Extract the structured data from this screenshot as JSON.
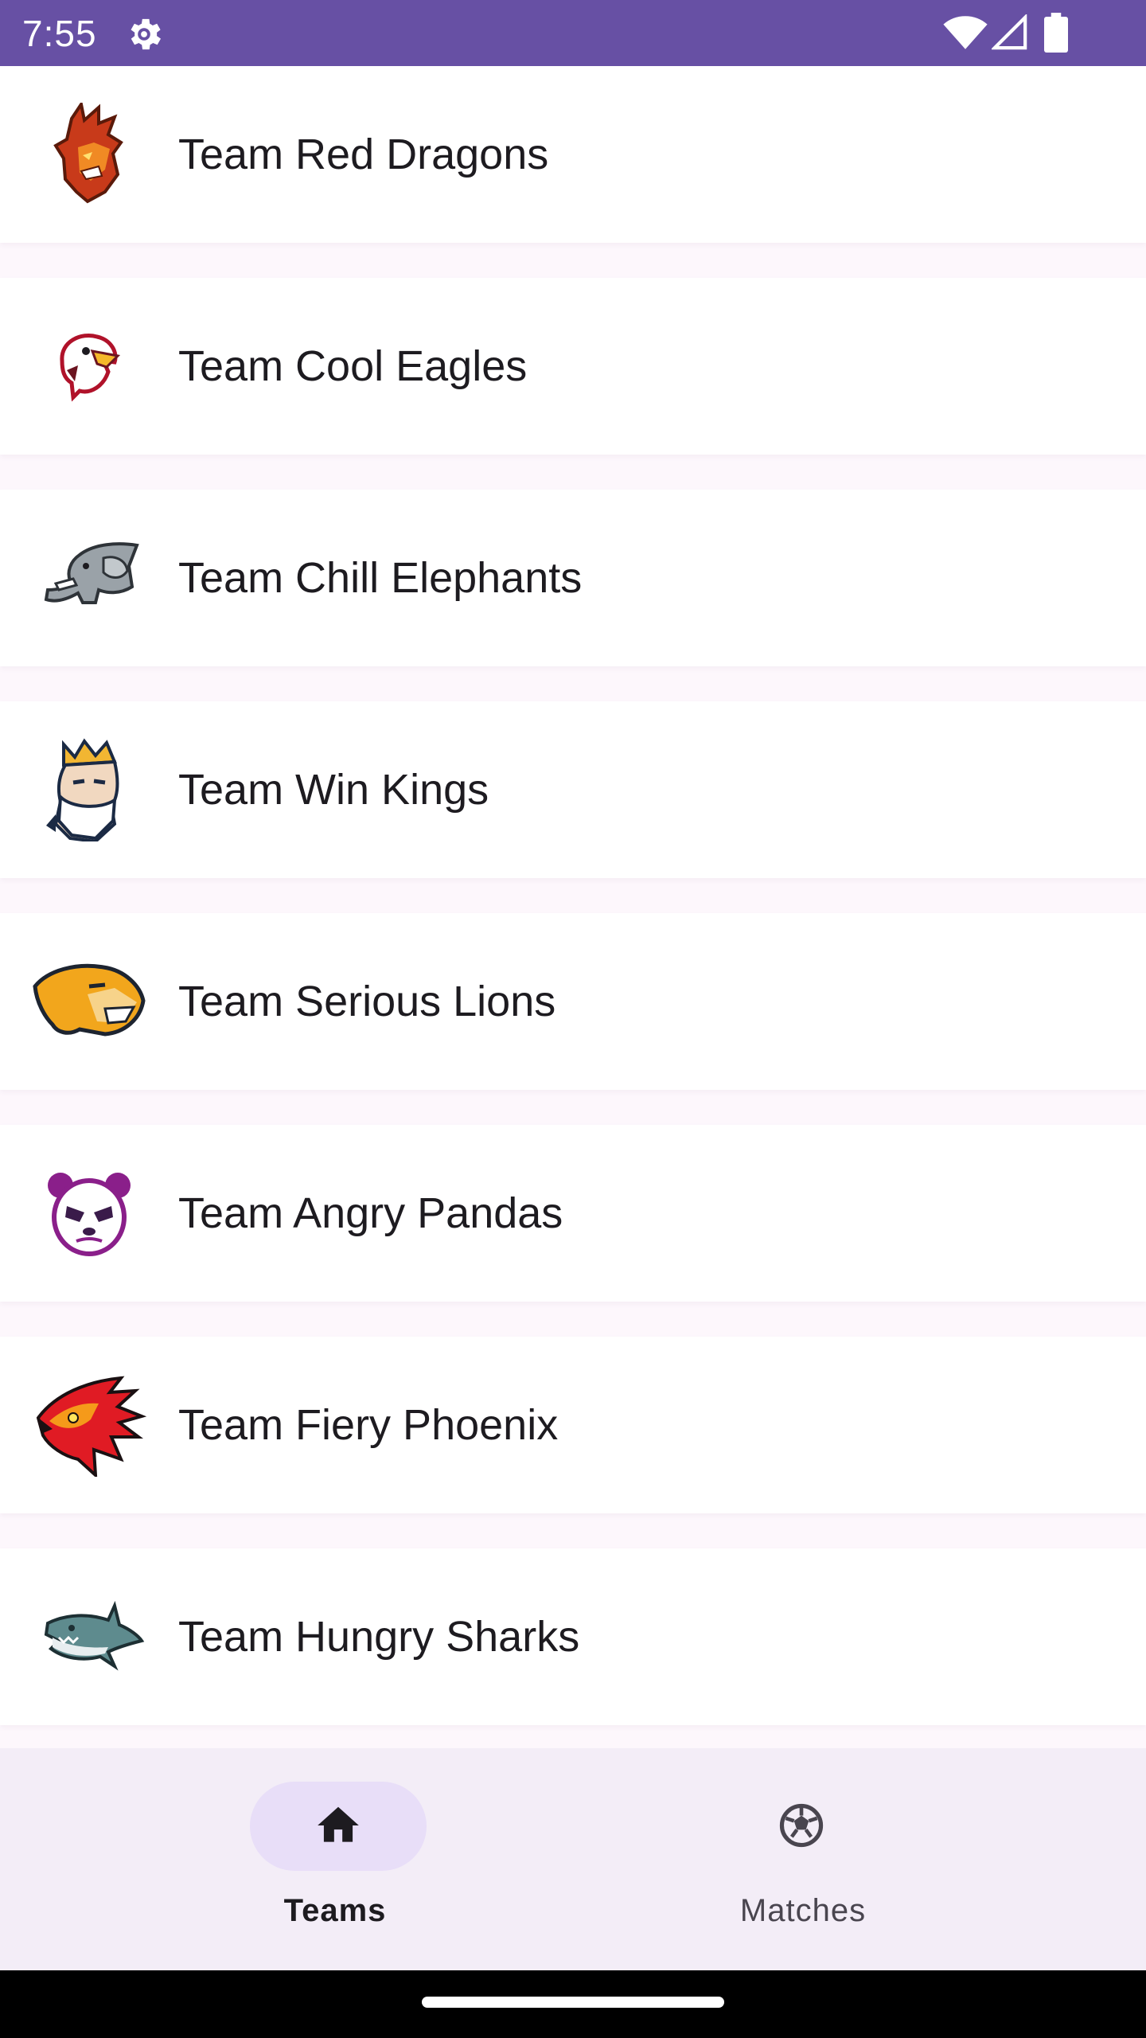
{
  "status_bar": {
    "time": "7:55",
    "background": "#6750a4",
    "icons": [
      "settings-gear-icon",
      "wifi-icon",
      "cell-signal-icon",
      "battery-icon"
    ]
  },
  "teams": [
    {
      "name": "Team Red Dragons",
      "logo": "red-dragon-logo"
    },
    {
      "name": "Team Cool Eagles",
      "logo": "eagle-logo"
    },
    {
      "name": "Team Chill Elephants",
      "logo": "elephant-logo"
    },
    {
      "name": "Team Win Kings",
      "logo": "king-logo"
    },
    {
      "name": "Team Serious Lions",
      "logo": "lion-logo"
    },
    {
      "name": "Team Angry Pandas",
      "logo": "panda-logo"
    },
    {
      "name": "Team Fiery Phoenix",
      "logo": "phoenix-logo"
    },
    {
      "name": "Team Hungry Sharks",
      "logo": "shark-logo"
    }
  ],
  "bottom_nav": {
    "items": [
      {
        "label": "Teams",
        "icon": "home-icon",
        "selected": true
      },
      {
        "label": "Matches",
        "icon": "soccer-ball-icon",
        "selected": false
      }
    ],
    "background": "#f3edf7",
    "active_indicator": "#e8def8"
  }
}
